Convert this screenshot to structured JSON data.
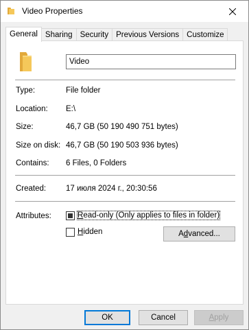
{
  "window": {
    "title": "Video Properties"
  },
  "tabs": [
    {
      "label": "General",
      "active": true
    },
    {
      "label": "Sharing",
      "active": false
    },
    {
      "label": "Security",
      "active": false
    },
    {
      "label": "Previous Versions",
      "active": false
    },
    {
      "label": "Customize",
      "active": false
    }
  ],
  "general": {
    "name_value": "Video",
    "type_label": "Type:",
    "type_value": "File folder",
    "location_label": "Location:",
    "location_value": "E:\\",
    "size_label": "Size:",
    "size_value": "46,7 GB (50 190 490 751 bytes)",
    "size_on_disk_label": "Size on disk:",
    "size_on_disk_value": "46,7 GB (50 190 503 936 bytes)",
    "contains_label": "Contains:",
    "contains_value": "6 Files, 0 Folders",
    "created_label": "Created:",
    "created_value": "17 июля 2024 г., 20:30:56",
    "attributes_label": "Attributes:",
    "readonly_first": "R",
    "readonly_rest": "ead-only (Only applies to files in folder)",
    "hidden_first": "H",
    "hidden_rest": "idden",
    "advanced_first": "",
    "advanced_underlined": "d",
    "advanced_pre": "A",
    "advanced_post": "vanced..."
  },
  "buttons": {
    "ok": "OK",
    "cancel": "Cancel",
    "apply_first": "A",
    "apply_rest": "pply"
  },
  "colors": {
    "folder": "#f5c85a",
    "folder_dark": "#e2a93b",
    "focus_blue": "#0078d7"
  },
  "icons": {
    "title": "folder-icon",
    "close": "close-icon",
    "big": "folder-icon"
  }
}
